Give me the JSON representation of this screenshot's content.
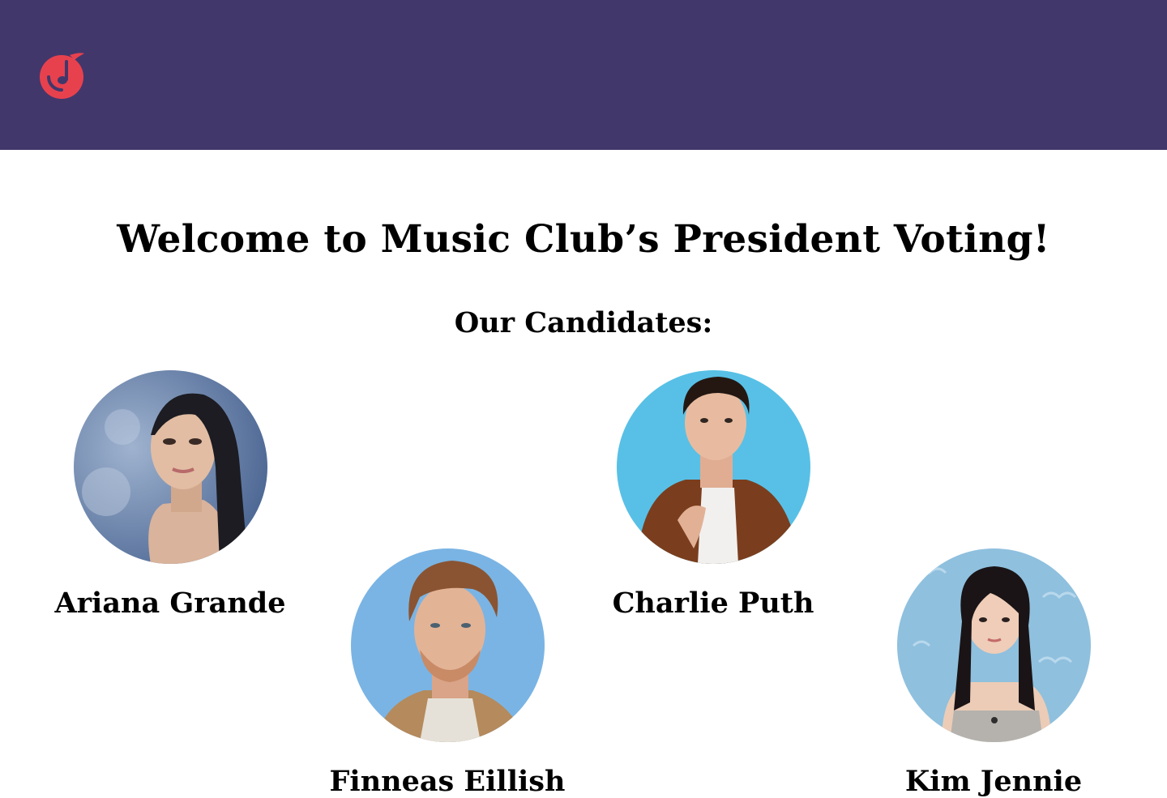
{
  "header": {
    "logo_icon": "music-note-logo-icon",
    "background_color": "#42376b",
    "logo_color": "#e8414e"
  },
  "main": {
    "title": "Welcome to Music Club’s President Voting!",
    "subtitle": "Our Candidates:"
  },
  "candidates": [
    {
      "name": "Ariana Grande",
      "photo": "portrait-photo"
    },
    {
      "name": "Finneas Eillish",
      "photo": "portrait-photo"
    },
    {
      "name": "Charlie Puth",
      "photo": "portrait-photo"
    },
    {
      "name": "Kim Jennie",
      "photo": "portrait-photo"
    }
  ]
}
